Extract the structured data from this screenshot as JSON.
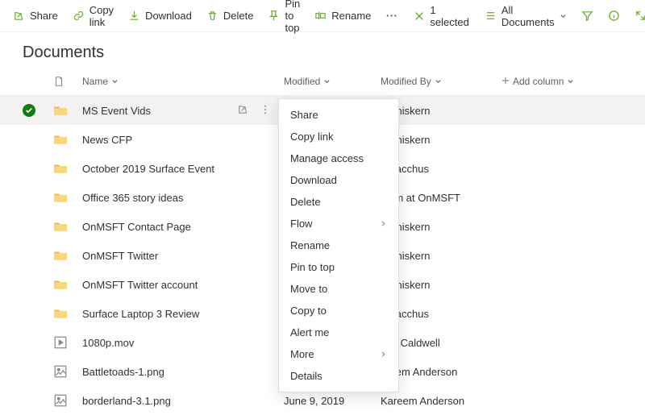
{
  "toolbar": {
    "share": "Share",
    "copy_link": "Copy link",
    "download": "Download",
    "delete": "Delete",
    "pin": "Pin to top",
    "rename": "Rename",
    "selected": "1 selected",
    "view": "All Documents"
  },
  "page_title": "Documents",
  "columns": {
    "name": "Name",
    "modified": "Modified",
    "modified_by": "Modified By",
    "add": "Add column"
  },
  "rows": [
    {
      "name": "MS Event Vids",
      "modified": "",
      "modified_by": "p Kniskern",
      "type": "folder",
      "selected": true
    },
    {
      "name": "News CFP",
      "modified": "",
      "modified_by": "p Kniskern",
      "type": "folder"
    },
    {
      "name": "October 2019 Surface Event",
      "modified": "",
      "modified_by": "if Bacchus",
      "type": "folder"
    },
    {
      "name": "Office 365 story ideas",
      "modified": "",
      "modified_by": "stem at OnMSFT",
      "type": "folder"
    },
    {
      "name": "OnMSFT Contact Page",
      "modified": "",
      "modified_by": "p Kniskern",
      "type": "folder"
    },
    {
      "name": "OnMSFT Twitter",
      "modified": "",
      "modified_by": "p Kniskern",
      "type": "folder"
    },
    {
      "name": "OnMSFT Twitter account",
      "modified": "",
      "modified_by": "p Kniskern",
      "type": "folder"
    },
    {
      "name": "Surface Laptop 3 Review",
      "modified": "",
      "modified_by": "if Bacchus",
      "type": "folder"
    },
    {
      "name": "1080p.mov",
      "modified": "",
      "modified_by": "nny Caldwell",
      "type": "video"
    },
    {
      "name": "Battletoads-1.png",
      "modified": "",
      "modified_by": "areem Anderson",
      "type": "image"
    },
    {
      "name": "borderland-3.1.png",
      "modified": "June 9, 2019",
      "modified_by": "Kareem Anderson",
      "type": "image"
    }
  ],
  "context_menu": [
    {
      "label": "Share"
    },
    {
      "label": "Copy link"
    },
    {
      "label": "Manage access"
    },
    {
      "label": "Download"
    },
    {
      "label": "Delete"
    },
    {
      "label": "Flow",
      "submenu": true
    },
    {
      "label": "Rename"
    },
    {
      "label": "Pin to top"
    },
    {
      "label": "Move to"
    },
    {
      "label": "Copy to"
    },
    {
      "label": "Alert me"
    },
    {
      "label": "More",
      "submenu": true
    },
    {
      "label": "Details"
    }
  ]
}
